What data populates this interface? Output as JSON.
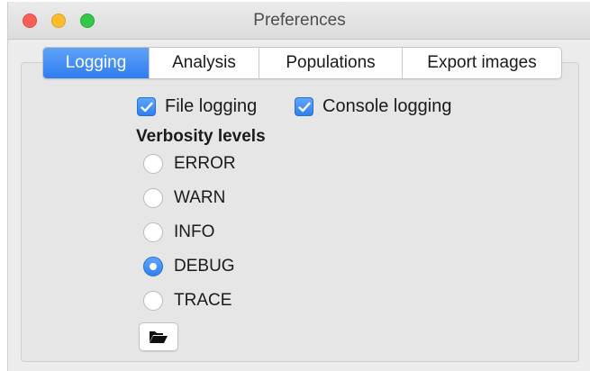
{
  "window": {
    "title": "Preferences"
  },
  "tabs": [
    {
      "label": "Logging",
      "active": true
    },
    {
      "label": "Analysis",
      "active": false
    },
    {
      "label": "Populations",
      "active": false
    },
    {
      "label": "Export images",
      "active": false
    }
  ],
  "logging": {
    "file_logging": {
      "label": "File logging",
      "checked": true
    },
    "console_logging": {
      "label": "Console logging",
      "checked": true
    },
    "verbosity_heading": "Verbosity levels",
    "levels": [
      {
        "label": "ERROR",
        "selected": false
      },
      {
        "label": "WARN",
        "selected": false
      },
      {
        "label": "INFO",
        "selected": false
      },
      {
        "label": "DEBUG",
        "selected": true
      },
      {
        "label": "TRACE",
        "selected": false
      }
    ],
    "folder_button_icon": "folder-open-icon"
  },
  "colors": {
    "accent": "#2f7ff1",
    "close": "#fc5f57",
    "minimize": "#fdbc2e",
    "maximize": "#34c84a"
  }
}
